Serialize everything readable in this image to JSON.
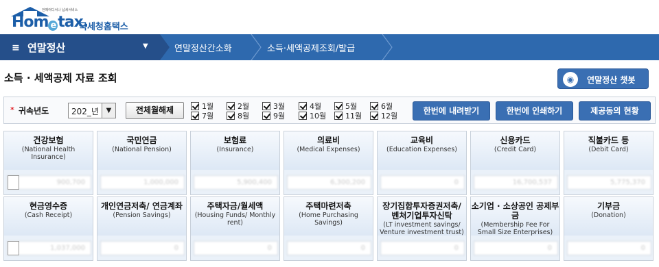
{
  "header": {
    "logo_tagline": "언제어디서나 납세서비스",
    "logo_brand_pre": "Hom",
    "logo_brand_e": "e",
    "logo_brand_post": "tax.",
    "logo_subbrand": "국세청홈택스"
  },
  "nav": {
    "menu_icon": "hamburger-icon",
    "menu_title": "연말정산",
    "crumb_1": "연말정산간소화",
    "crumb_2": "소득·세액공제조회/발급"
  },
  "page": {
    "title": "소득 · 세액공제 자료 조회",
    "chatbot_label": "연말정산 챗봇"
  },
  "filter": {
    "year_label": "귀속년도",
    "year_value": "202_년",
    "toggle_all_label": "전체월해제",
    "months": [
      "1월",
      "2월",
      "3월",
      "4월",
      "5월",
      "6월",
      "7월",
      "8월",
      "9월",
      "10월",
      "11월",
      "12월"
    ],
    "download_label": "한번에 내려받기",
    "print_label": "한번에 인쇄하기",
    "company_label": "제공동의 현황"
  },
  "cards": [
    {
      "ko": "건강보험",
      "en": "(National Health Insurance)",
      "amount": "900,700"
    },
    {
      "ko": "국민연금",
      "en": "(National Pension)",
      "amount": "1,000,000"
    },
    {
      "ko": "보험료",
      "en": "(Insurance)",
      "amount": "5,900,400"
    },
    {
      "ko": "의료비",
      "en": "(Medical Expenses)",
      "amount": "6,300,200"
    },
    {
      "ko": "교육비",
      "en": "(Education Expenses)",
      "amount": "0"
    },
    {
      "ko": "신용카드",
      "en": "(Credit Card)",
      "amount": "16,700,537"
    },
    {
      "ko": "직불카드 등",
      "en": "(Debit Card)",
      "amount": "5,775,370"
    },
    {
      "ko": "현금영수증",
      "en": "(Cash Receipt)",
      "amount": "1,037,000"
    },
    {
      "ko": "개인연금저축/ 연금계좌",
      "en": "(Pension Savings)",
      "amount": "0"
    },
    {
      "ko": "주택자금/월세액",
      "en": "(Housing Funds/ Monthly rent)",
      "amount": "0"
    },
    {
      "ko": "주택마련저축",
      "en": "(Home Purchasing Savings)",
      "amount": "0"
    },
    {
      "ko": "장기집합투자증권저축/ 벤처기업투자신탁",
      "en": "(LT investment savings/ Venture investment trust)",
      "amount": "0"
    },
    {
      "ko": "소기업 · 소상공인 공제부금",
      "en": "(Membership Fee For Small Size Enterprises)",
      "amount": "0"
    },
    {
      "ko": "기부금",
      "en": "(Donation)",
      "amount": "0"
    }
  ],
  "colors": {
    "nav_bg": "#2e69ae",
    "nav_main_bg": "#254f8a",
    "button_blue": "#3a6fb3",
    "required_star": "#e2242b"
  }
}
